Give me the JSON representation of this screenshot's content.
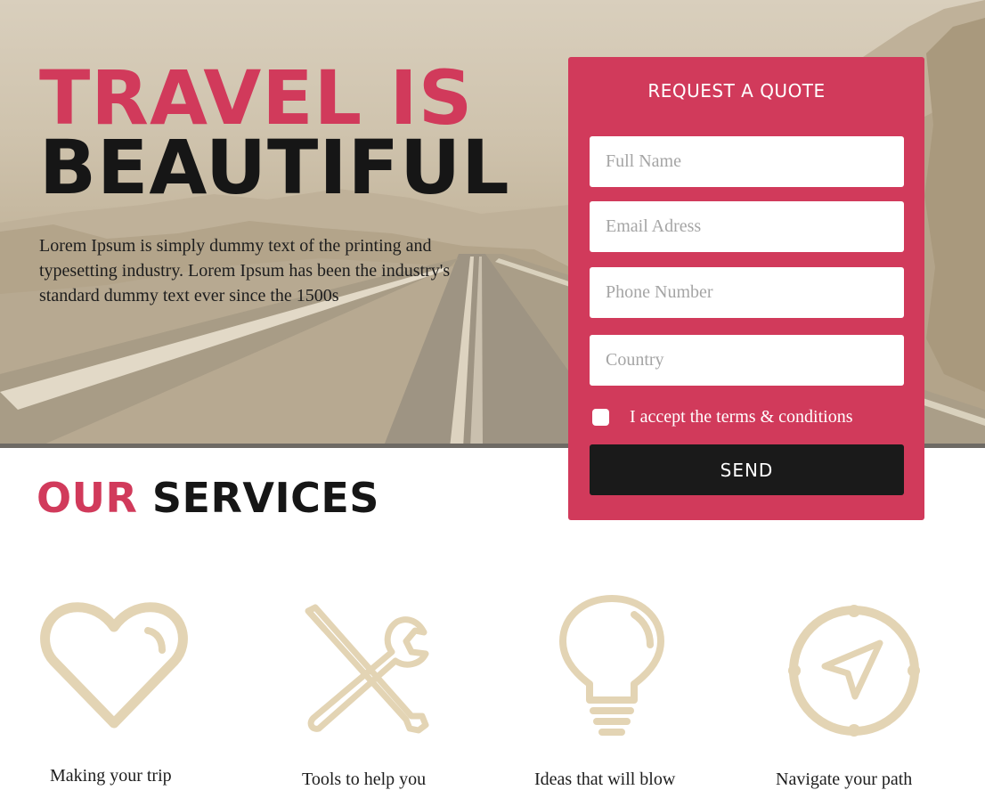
{
  "hero": {
    "title_line1": "TRAVEL IS",
    "title_line2": "BEAUTIFUL",
    "description": "Lorem Ipsum is simply dummy text of the printing and typesetting industry. Lorem Ipsum has been the industry's standard dummy text ever since the 1500s"
  },
  "quote_form": {
    "title": "REQUEST A QUOTE",
    "fields": {
      "full_name": {
        "placeholder": "Full Name",
        "value": ""
      },
      "email": {
        "placeholder": "Email Adress",
        "value": ""
      },
      "phone": {
        "placeholder": "Phone Number",
        "value": ""
      },
      "country": {
        "placeholder": "Country",
        "value": ""
      }
    },
    "terms_label": "I accept the terms & conditions",
    "terms_checked": false,
    "submit_label": "SEND"
  },
  "services": {
    "title_accent": "OUR",
    "title_rest": "SERVICES",
    "items": [
      {
        "icon": "heart-icon",
        "label": "Making your trip"
      },
      {
        "icon": "tools-icon",
        "label": "Tools to help you"
      },
      {
        "icon": "lightbulb-icon",
        "label": "Ideas that will blow"
      },
      {
        "icon": "compass-icon",
        "label": "Navigate your path"
      }
    ]
  },
  "colors": {
    "accent": "#d13a5b",
    "dark": "#161616",
    "icon": "#e3d4b4",
    "hero_tint": "#cfc3ad"
  }
}
